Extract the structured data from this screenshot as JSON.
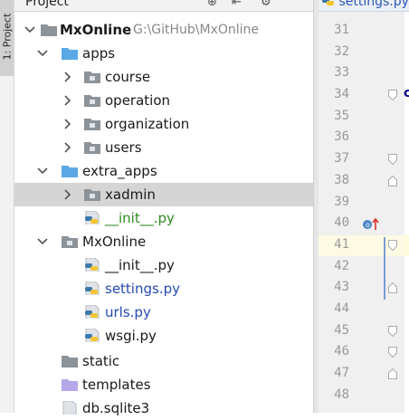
{
  "project_panel": {
    "title": "Project",
    "stripe_label": "1: Project"
  },
  "tree": {
    "root": {
      "label": "MxOnline",
      "path": "G:\\GitHub\\MxOnline"
    },
    "rows": [
      {
        "label": "apps"
      },
      {
        "label": "course"
      },
      {
        "label": "operation"
      },
      {
        "label": "organization"
      },
      {
        "label": "users"
      },
      {
        "label": "extra_apps"
      },
      {
        "label": "xadmin"
      },
      {
        "label": "__init__.py"
      },
      {
        "label": "MxOnline"
      },
      {
        "label": "__init__.py"
      },
      {
        "label": "settings.py"
      },
      {
        "label": "urls.py"
      },
      {
        "label": "wsgi.py"
      },
      {
        "label": "static"
      },
      {
        "label": "templates"
      },
      {
        "label": "db.sqlite3"
      }
    ]
  },
  "editor": {
    "tab_label": "settings.py",
    "line_numbers": [
      "31",
      "32",
      "33",
      "34",
      "35",
      "36",
      "37",
      "38",
      "39",
      "40",
      "41",
      "42",
      "43",
      "44",
      "45",
      "46",
      "47",
      "48"
    ],
    "current_line": "41"
  },
  "colors": {
    "folder_blue": "#5aa9e6",
    "folder_gray": "#8c9399",
    "folder_purple": "#b5a7e8",
    "selected_row": "#d5d5d5",
    "modified_file_blue": "#2649b4",
    "new_file_green": "#2f8a23"
  }
}
